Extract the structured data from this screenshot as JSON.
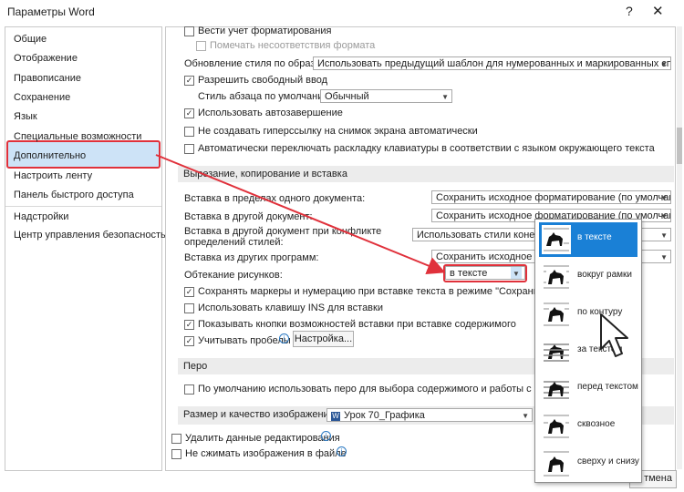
{
  "window": {
    "title": "Параметры Word",
    "help_glyph": "?",
    "close_glyph": "✕"
  },
  "nav": {
    "items": [
      {
        "label": "Общие"
      },
      {
        "label": "Отображение"
      },
      {
        "label": "Правописание"
      },
      {
        "label": "Сохранение"
      },
      {
        "label": "Язык"
      },
      {
        "label": "Специальные возможности"
      },
      {
        "label": "Дополнительно"
      },
      {
        "label": "Настроить ленту"
      },
      {
        "label": "Панель быстрого доступа"
      },
      {
        "label": "Надстройки"
      },
      {
        "label": "Центр управления безопасностью"
      }
    ],
    "selected": "Дополнительно"
  },
  "editing": {
    "track_formatting": "Вести учет форматирования",
    "mark_inconsistencies": "Помечать несоответствия формата",
    "style_update_label": "Обновление стиля по образцу:",
    "style_update_value": "Использовать предыдущий шаблон для нумерованных и маркированных списков",
    "free_input": "Разрешить свободный ввод",
    "default_style_label": "Стиль абзаца по умолчанию:",
    "default_style_value": "Обычный",
    "autocomplete": "Использовать автозавершение",
    "no_hyperlink": "Не создавать гиперссылку на снимок экрана автоматически",
    "auto_keyboard": "Автоматически переключать раскладку клавиатуры в соответствии с языком окружающего текста"
  },
  "cutcopy": {
    "section_title": "Вырезание, копирование и вставка",
    "within_doc_label": "Вставка в пределах одного документа:",
    "within_doc_value": "Сохранить исходное форматирование (по умолчанию)",
    "other_doc_label": "Вставка в другой документ:",
    "other_doc_value": "Сохранить исходное форматирование (по умолчанию)",
    "conflict_label_1": "Вставка в другой документ при конфликте",
    "conflict_label_2": "определений стилей:",
    "conflict_value": "Использовать стили конечного",
    "other_prog_label": "Вставка из других программ:",
    "other_prog_value": "Сохранить исходное форм",
    "wrap_label": "Обтекание рисунков:",
    "wrap_value": "в тексте",
    "keep_bullets": "Сохранять маркеры и нумерацию при вставке текста в режиме \"Сохранить только т",
    "use_ins": "Использовать клавишу INS для вставки",
    "show_paste_buttons": "Показывать кнопки возможностей вставки при вставке содержимого",
    "smart_spaces": "Учитывать пробелы",
    "settings_button": "Настройка..."
  },
  "pen": {
    "section_title": "Перо",
    "default_pen": "По умолчанию использовать перо для выбора содержимого и работы с ним"
  },
  "image": {
    "section_title": "Размер и качество изображения",
    "doc_value": "Урок 70_Графика",
    "delete_editing": "Удалить данные редактирования",
    "no_compress": "Не сжимать изображения в файле"
  },
  "footer": {
    "cancel_partial": "тмена"
  },
  "wrap_popup": {
    "items": [
      {
        "label": "в тексте",
        "icon": "wrap-inline-icon"
      },
      {
        "label": "вокруг рамки",
        "icon": "wrap-square-icon"
      },
      {
        "label": "по контуру",
        "icon": "wrap-tight-icon"
      },
      {
        "label": "за текстом",
        "icon": "wrap-behind-icon"
      },
      {
        "label": "перед текстом",
        "icon": "wrap-front-icon"
      },
      {
        "label": "сквозное",
        "icon": "wrap-through-icon"
      },
      {
        "label": "сверху и снизу",
        "icon": "wrap-topbottom-icon"
      }
    ],
    "selected": "в тексте"
  },
  "colors": {
    "accent": "#1a80d6",
    "highlight": "#e0313b",
    "nav_selected": "#cde3f7"
  }
}
